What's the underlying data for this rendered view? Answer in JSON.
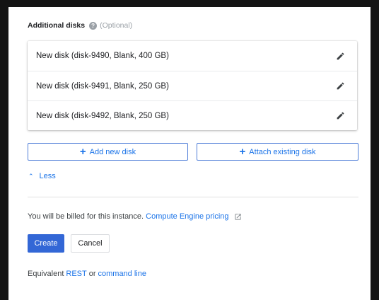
{
  "section": {
    "title": "Additional disks",
    "help_icon": "?",
    "optional": "(Optional)"
  },
  "disks": [
    {
      "label": "New disk (disk-9490, Blank, 400 GB)"
    },
    {
      "label": "New disk (disk-9491, Blank, 250 GB)"
    },
    {
      "label": "New disk (disk-9492, Blank, 250 GB)"
    }
  ],
  "actions": {
    "plus": "+",
    "add_new": "Add new disk",
    "attach_existing": "Attach existing disk"
  },
  "less": {
    "chevron": "⌃",
    "label": "Less"
  },
  "billing": {
    "text": "You will be billed for this instance.",
    "link": "Compute Engine pricing"
  },
  "buttons": {
    "create": "Create",
    "cancel": "Cancel"
  },
  "rest": {
    "prefix": "Equivalent",
    "rest_link": "REST",
    "or": "or",
    "cli_link": "command line"
  },
  "colors": {
    "accent": "#1a73e8",
    "primary_button": "#3367d6",
    "background": "#141414"
  }
}
